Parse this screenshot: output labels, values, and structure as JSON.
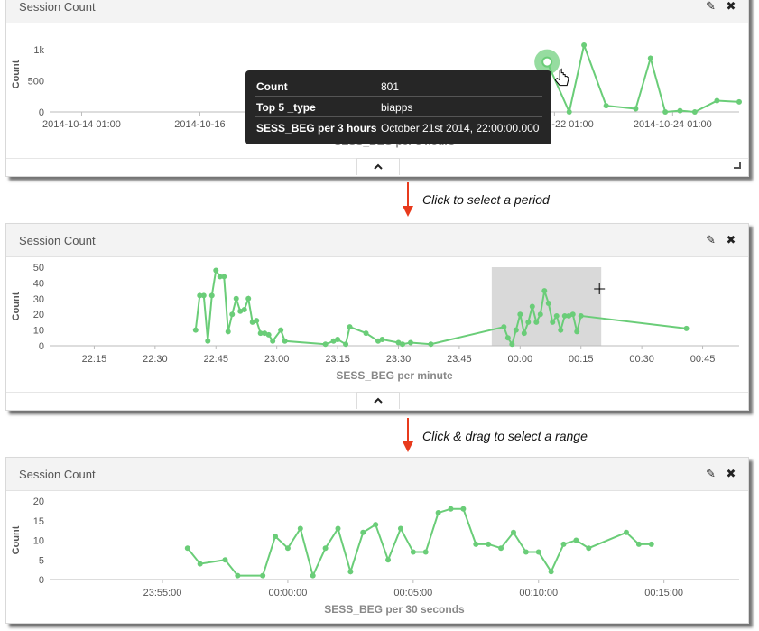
{
  "panels": [
    {
      "title": "Session Count",
      "chart_data": {
        "type": "line",
        "title": "Session Count",
        "ylabel": "Count",
        "xlabel": "SESS_BEG per 3 hours",
        "x_tick_labels": [
          "2014-10-14 01:00",
          "2014-10-16",
          "2014-10-22 01:00",
          "2014-10-24 01:00"
        ],
        "y_ticks": [
          0,
          500,
          1000
        ],
        "y_tick_labels": [
          "0",
          "500",
          "1k"
        ],
        "ylim": [
          0,
          1200
        ],
        "series": [
          {
            "x": [
              "2014-10-21 22:00",
              "2014-10-22 07:00",
              "2014-10-22 13:00",
              "2014-10-22 22:00",
              "2014-10-23 10:00",
              "2014-10-23 16:00",
              "2014-10-23 22:00",
              "2014-10-24 04:00",
              "2014-10-24 10:00",
              "2014-10-24 19:00",
              "2014-10-25 04:00"
            ],
            "values": [
              801,
              0,
              1070,
              100,
              50,
              860,
              0,
              20,
              0,
              180,
              160
            ]
          }
        ],
        "grid": false
      }
    },
    {
      "title": "Session Count",
      "chart_data": {
        "type": "line",
        "title": "Session Count",
        "ylabel": "Count",
        "xlabel": "SESS_BEG per minute",
        "x_tick_labels": [
          "22:15",
          "22:30",
          "22:45",
          "23:00",
          "23:15",
          "23:30",
          "23:45",
          "00:00",
          "00:15",
          "00:30",
          "00:45"
        ],
        "y_ticks": [
          0,
          10,
          20,
          30,
          40,
          50
        ],
        "ylim": [
          0,
          50
        ],
        "series": [
          {
            "x": [
              "22:40",
              "22:41",
              "22:42",
              "22:43",
              "22:44",
              "22:45",
              "22:46",
              "22:47",
              "22:48",
              "22:49",
              "22:50",
              "22:51",
              "22:52",
              "22:53",
              "22:54",
              "22:55",
              "22:56",
              "22:57",
              "22:58",
              "22:59",
              "23:01",
              "23:02",
              "23:12",
              "23:14",
              "23:15",
              "23:17",
              "23:18",
              "23:22",
              "23:25",
              "23:26",
              "23:30",
              "23:31",
              "23:33",
              "23:38",
              "23:56",
              "23:57",
              "23:58",
              "23:59",
              "00:00",
              "00:01",
              "00:02",
              "00:03",
              "00:04",
              "00:05",
              "00:06",
              "00:07",
              "00:08",
              "00:09",
              "00:10",
              "00:11",
              "00:12",
              "00:13",
              "00:14",
              "00:15",
              "00:41"
            ],
            "values": [
              10,
              32,
              32,
              3,
              32,
              48,
              44,
              44,
              9,
              20,
              30,
              22,
              23,
              30,
              15,
              16,
              8,
              8,
              7,
              3,
              10,
              3,
              1,
              3,
              4,
              1,
              12,
              8,
              3,
              4,
              2,
              1,
              2,
              1,
              12,
              5,
              1,
              10,
              20,
              8,
              15,
              25,
              15,
              20,
              35,
              27,
              15,
              19,
              10,
              19,
              19,
              20,
              9,
              19,
              11
            ]
          }
        ],
        "selection": {
          "from": "23:53",
          "to": "00:20"
        },
        "grid": false
      }
    },
    {
      "title": "Session Count",
      "chart_data": {
        "type": "line",
        "title": "Session Count",
        "ylabel": "Count",
        "xlabel": "SESS_BEG per 30 seconds",
        "x_tick_labels": [
          "23:55:00",
          "00:00:00",
          "00:05:00",
          "00:10:00",
          "00:15:00"
        ],
        "y_ticks": [
          0,
          5,
          10,
          15,
          20
        ],
        "ylim": [
          0,
          20
        ],
        "series": [
          {
            "x": [
              "23:56:00",
              "23:56:30",
              "23:57:30",
              "23:58:00",
              "23:59:00",
              "23:59:30",
              "00:00:00",
              "00:00:30",
              "00:01:00",
              "00:01:30",
              "00:02:00",
              "00:02:30",
              "00:03:00",
              "00:03:30",
              "00:04:00",
              "00:04:30",
              "00:05:00",
              "00:05:30",
              "00:06:00",
              "00:06:30",
              "00:07:00",
              "00:07:30",
              "00:08:00",
              "00:08:30",
              "00:09:00",
              "00:09:30",
              "00:10:00",
              "00:10:30",
              "00:11:00",
              "00:11:30",
              "00:12:00",
              "00:13:30",
              "00:14:00",
              "00:14:30"
            ],
            "values": [
              8,
              4,
              5,
              1,
              1,
              11,
              8,
              13,
              1,
              8,
              13,
              2,
              12,
              14,
              5,
              13,
              7,
              7,
              17,
              18,
              18,
              9,
              9,
              8,
              12,
              7,
              7,
              2,
              9,
              10,
              8,
              12,
              9,
              9
            ]
          }
        ],
        "grid": false
      }
    }
  ],
  "tooltip": {
    "rows": [
      {
        "key": "Count",
        "value": "801"
      },
      {
        "key": "Top 5 _type",
        "value": "biapps"
      },
      {
        "key": "SESS_BEG per 3 hours",
        "value": "October 21st 2014, 22:00:00.000"
      }
    ]
  },
  "annotations": {
    "step1": "Click to select a period",
    "step2": "Click & drag to select a range"
  },
  "colors": {
    "line": "#6acd78",
    "axis_text": "#555555",
    "arrow": "#e83a1c",
    "selection": "#d9d9d9",
    "tooltip_bg": "#262626"
  },
  "icons": {
    "edit": "pencil-icon",
    "close": "close-icon",
    "toggle": "chevron-up-icon",
    "cursor": "hand-pointer-icon",
    "crosshair": "crosshair-icon"
  }
}
